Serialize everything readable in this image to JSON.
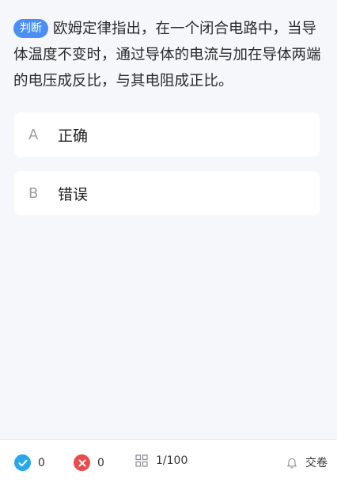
{
  "question": {
    "type_tag": "判断",
    "text": "欧姆定律指出，在一个闭合电路中，当导体温度不变时，通过导体的电流与加在导体两端的电压成反比，与其电阻成正比。"
  },
  "options": [
    {
      "letter": "A",
      "text": "正确"
    },
    {
      "letter": "B",
      "text": "错误"
    }
  ],
  "footer": {
    "correct_count": "0",
    "wrong_count": "0",
    "progress": "1/100",
    "submit_label": "交卷"
  },
  "colors": {
    "tag_bg": "#4b8ff5",
    "correct": "#2aa7e8",
    "wrong": "#ec4b4b"
  }
}
